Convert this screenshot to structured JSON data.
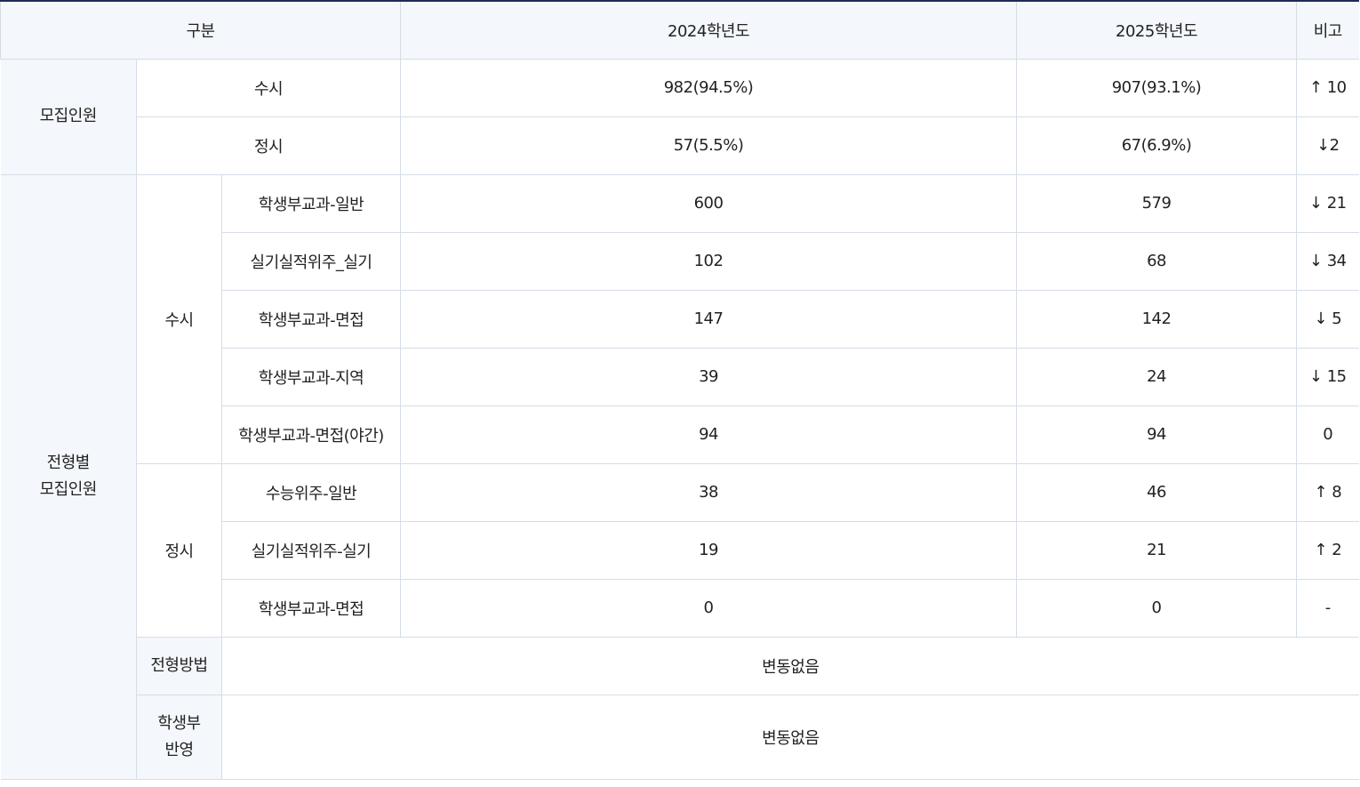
{
  "header": {
    "category": "구분",
    "year_2024": "2024학년도",
    "year_2025": "2025학년도",
    "note": "비고"
  },
  "recruit_total": {
    "label": "모집인원",
    "rows": [
      {
        "name": "수시",
        "y2024": "982(94.5%)",
        "y2025": "907(93.1%)",
        "note": "↑ 10"
      },
      {
        "name": "정시",
        "y2024": "57(5.5%)",
        "y2025": "67(6.9%)",
        "note": "↓2"
      }
    ]
  },
  "by_type": {
    "label_line1": "전형별",
    "label_line2": "모집인원",
    "susi": {
      "label": "수시",
      "rows": [
        {
          "name": "학생부교과-일반",
          "y2024": "600",
          "y2025": "579",
          "note": "↓ 21"
        },
        {
          "name": "실기실적위주_실기",
          "y2024": "102",
          "y2025": "68",
          "note": "↓ 34"
        },
        {
          "name": "학생부교과-면접",
          "y2024": "147",
          "y2025": "142",
          "note": "↓ 5"
        },
        {
          "name": "학생부교과-지역",
          "y2024": "39",
          "y2025": "24",
          "note": "↓ 15"
        },
        {
          "name": "학생부교과-면접(야간)",
          "y2024": "94",
          "y2025": "94",
          "note": "0"
        }
      ]
    },
    "jeongsi": {
      "label": "정시",
      "rows": [
        {
          "name": "수능위주-일반",
          "y2024": "38",
          "y2025": "46",
          "note": "↑ 8"
        },
        {
          "name": "실기실적위주-실기",
          "y2024": "19",
          "y2025": "21",
          "note": "↑ 2"
        },
        {
          "name": "학생부교과-면접",
          "y2024": "0",
          "y2025": "0",
          "note": "-"
        }
      ]
    },
    "method": {
      "label": "전형방법",
      "value": "변동없음"
    },
    "record": {
      "label_line1": "학생부",
      "label_line2": "반영",
      "value": "변동없음"
    }
  }
}
